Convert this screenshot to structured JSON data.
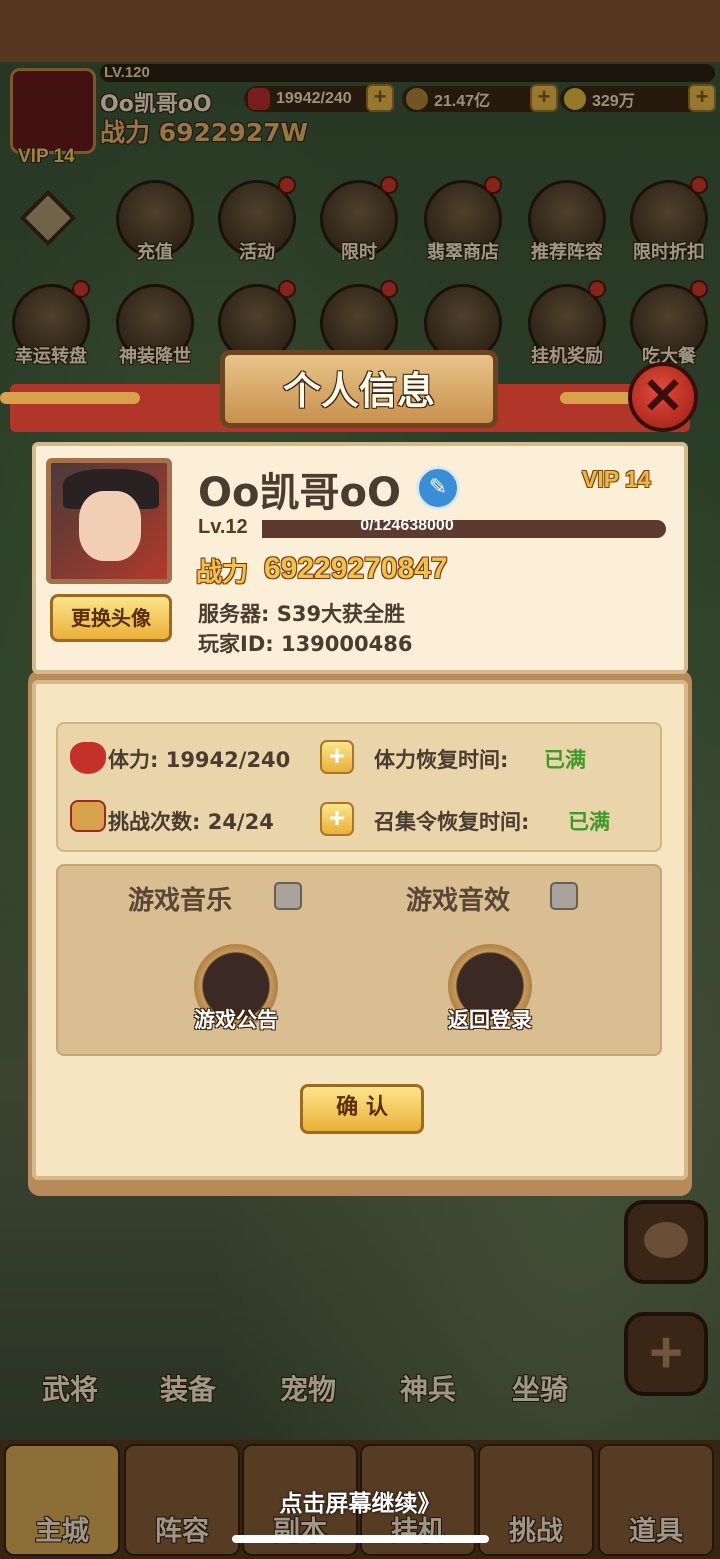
{
  "topbar": {
    "level": "LV.120",
    "name": "Oo凯哥oO",
    "power_label": "战力",
    "power_value": "6922927W",
    "vip": "VIP 14",
    "stamina": "19942/240",
    "coins": "21.47亿",
    "gold": "329万"
  },
  "menu_row1": [
    {
      "label": "充值",
      "icon": "gold-ingot-icon"
    },
    {
      "label": "活动",
      "icon": "scroll-icon"
    },
    {
      "label": "限时",
      "icon": "gift-box-icon"
    },
    {
      "label": "翡翠商店",
      "icon": "jade-icon"
    },
    {
      "label": "推荐阵容",
      "icon": "crossed-swords-icon"
    },
    {
      "label": "限时折扣",
      "icon": "hourglass-icon"
    }
  ],
  "menu_row2": [
    {
      "label": "幸运转盘",
      "icon": "wheel-icon"
    },
    {
      "label": "神装降世",
      "icon": "armor-icon"
    },
    {
      "label": "",
      "icon": "drink-icon"
    },
    {
      "label": "",
      "icon": "gift-icon"
    },
    {
      "label": "",
      "icon": "bow-gift-icon"
    },
    {
      "label": "挂机奖励",
      "icon": "treasure-chest-icon"
    },
    {
      "label": "吃大餐",
      "icon": "roast-chicken-icon"
    }
  ],
  "modal": {
    "title": "个人信息",
    "close_icon": "close-icon",
    "profile": {
      "name": "Oo凯哥oO",
      "vip": "VIP 14",
      "level": "Lv.12",
      "exp": "0/124638000",
      "power_label": "战力",
      "power_value": "69229270847",
      "change_avatar": "更换头像",
      "server": "服务器:  S39大获全胜",
      "player_id": "玩家ID:  139000486"
    },
    "stats": {
      "stamina_label": "体力: 19942/240",
      "stamina_recover_label": "体力恢复时间:",
      "stamina_recover_value": "已满",
      "challenge_label": "挑战次数: 24/24",
      "summon_recover_label": "召集令恢复时间:",
      "summon_recover_value": "已满"
    },
    "settings": {
      "music": "游戏音乐",
      "sound": "游戏音效",
      "notice": "游戏公告",
      "back_login": "返回登录"
    },
    "confirm": "确 认"
  },
  "bottom_menu": [
    "武将",
    "装备",
    "宠物",
    "神兵",
    "坐骑"
  ],
  "bottom_nav": [
    "主城",
    "阵容",
    "副本",
    "挂机",
    "挑战",
    "道具"
  ],
  "tap_hint": "点击屏幕继续》",
  "colors": {
    "accent_gold": "#f2c24b",
    "status_green": "#3f9a2a",
    "close_red": "#d63c2a"
  }
}
